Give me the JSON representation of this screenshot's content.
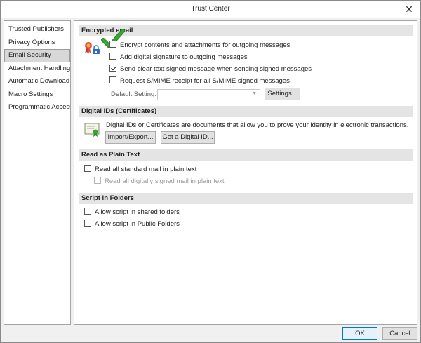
{
  "window": {
    "title": "Trust Center",
    "close_label": "✕"
  },
  "sidebar": {
    "items": [
      {
        "label": "Trusted Publishers"
      },
      {
        "label": "Privacy Options"
      },
      {
        "label": "Email Security",
        "active": true
      },
      {
        "label": "Attachment Handling"
      },
      {
        "label": "Automatic Download"
      },
      {
        "label": "Macro Settings"
      },
      {
        "label": "Programmatic Access"
      }
    ]
  },
  "encrypted": {
    "header": "Encrypted email",
    "options": [
      {
        "label": "Encrypt contents and attachments for outgoing messages",
        "checked": false
      },
      {
        "label": "Add digital signature to outgoing messages",
        "checked": false
      },
      {
        "label": "Send clear text signed message when sending signed messages",
        "checked": true
      },
      {
        "label": "Request S/MIME receipt for all S/MIME signed messages",
        "checked": false
      }
    ],
    "default_setting_label": "Default Setting:",
    "default_setting_value": "",
    "settings_button": "Settings..."
  },
  "digital_ids": {
    "header": "Digital IDs (Certificates)",
    "description": "Digital IDs or Certificates are documents that allow you to prove your identity in electronic transactions.",
    "import_export_button": "Import/Export...",
    "get_id_button": "Get a Digital ID..."
  },
  "plain_text": {
    "header": "Read as Plain Text",
    "options": [
      {
        "label": "Read all standard mail in plain text",
        "checked": false,
        "disabled": false
      },
      {
        "label": "Read all digitally signed mail in plain text",
        "checked": false,
        "disabled": true
      }
    ]
  },
  "script_folders": {
    "header": "Script in Folders",
    "options": [
      {
        "label": "Allow script in shared folders",
        "checked": false
      },
      {
        "label": "Allow script in Public Folders",
        "checked": false
      }
    ]
  },
  "footer": {
    "ok_button": "OK",
    "cancel_button": "Cancel"
  },
  "colors": {
    "accent": "#0078d7",
    "check_green": "#3aa635",
    "section_bg": "#e4e4e4"
  },
  "icons": {
    "certificate": "certificate-ribbon-icon",
    "lock": "lock-icon",
    "check": "green-checkmark-icon",
    "digital_id": "digital-id-certificate-icon"
  }
}
